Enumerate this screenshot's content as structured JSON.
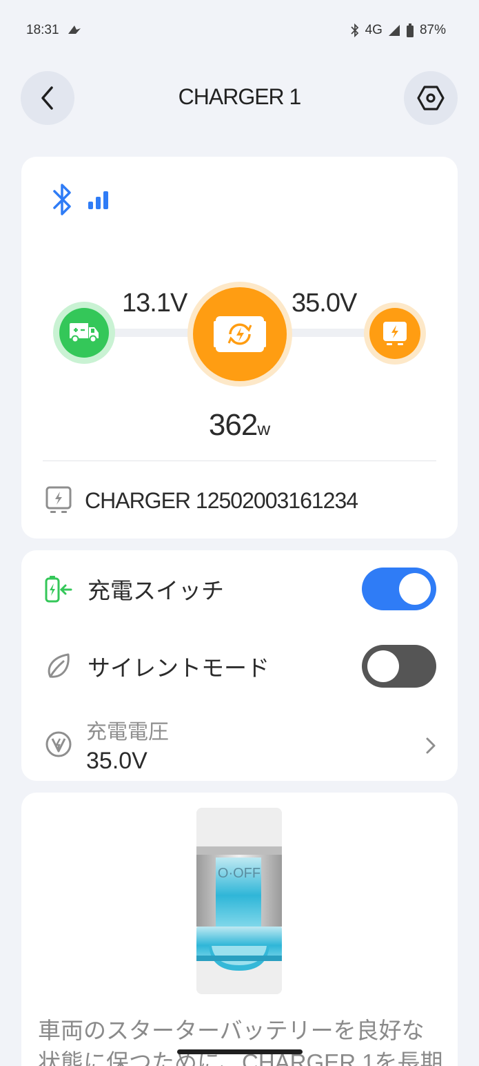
{
  "status_bar": {
    "time": "18:31",
    "network": "4G",
    "battery": "87%"
  },
  "header": {
    "title": "CHARGER 1",
    "back_icon": "chevron-left-icon",
    "settings_icon": "hex-nut-settings-icon"
  },
  "connection": {
    "bluetooth_icon": "bluetooth-icon",
    "signal_icon": "signal-bars-icon",
    "signal_level": 3
  },
  "flow": {
    "input_voltage": "13.1V",
    "output_voltage": "35.0V",
    "power_value": "362",
    "power_unit": "w",
    "colors": {
      "vehicle": "#34c759",
      "charger": "#ff9d12",
      "battery": "#ff9d12"
    }
  },
  "device": {
    "name": "CHARGER 12502003161234"
  },
  "settings": {
    "charge_switch": {
      "label": "充電スイッチ",
      "on": true
    },
    "silent_mode": {
      "label": "サイレントモード",
      "on": false
    },
    "charge_voltage": {
      "label": "充電電圧",
      "value": "35.0V"
    }
  },
  "info": {
    "breaker_label": "O·OFF",
    "text": "車両のスターターバッテリーを良好な状態に保つために、CHARGER 1を長期"
  },
  "colors": {
    "accent": "#2f7cf6",
    "green": "#34c759",
    "orange": "#ff9d12"
  }
}
